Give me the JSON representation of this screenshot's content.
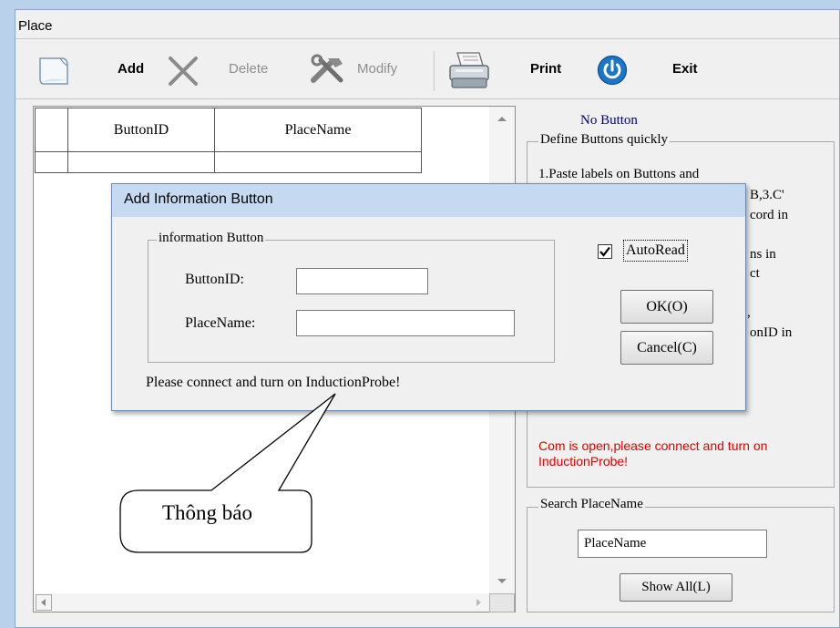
{
  "window": {
    "title": "Place"
  },
  "toolbar": {
    "add_label": "Add",
    "delete_label": "Delete",
    "modify_label": "Modify",
    "print_label": "Print",
    "exit_label": "Exit"
  },
  "grid": {
    "columns": [
      "ButtonID",
      "PlaceName"
    ],
    "rows": [
      [
        "",
        ""
      ]
    ]
  },
  "status": {
    "no_button": "No Button"
  },
  "define_group": {
    "legend": "Define Buttons quickly",
    "visible_lines": [
      "1.Paste labels on Buttons and",
      "B,3.C'",
      "cord in",
      "ns in",
      "ct",
      ",",
      "onID in"
    ],
    "com_message": "Com is open,please connect and turn on InductionProbe!"
  },
  "search_group": {
    "legend": "Search PlaceName",
    "input_value": "PlaceName",
    "show_all_label": "Show All(L)"
  },
  "dialog": {
    "title": "Add Information Button",
    "group_legend": "information Button",
    "buttonid_label": "ButtonID:",
    "buttonid_value": "",
    "placename_label": "PlaceName:",
    "placename_value": "",
    "autoread_label": "AutoRead",
    "autoread_checked": true,
    "ok_label": "OK(O)",
    "cancel_label": "Cancel(C)",
    "message": "Please connect and turn on InductionProbe!"
  },
  "callout": {
    "text": "Thông báo"
  },
  "colors": {
    "status_blue": "#000080",
    "com_red": "#e00000",
    "dialog_title_bg": "#c5d9f0"
  }
}
